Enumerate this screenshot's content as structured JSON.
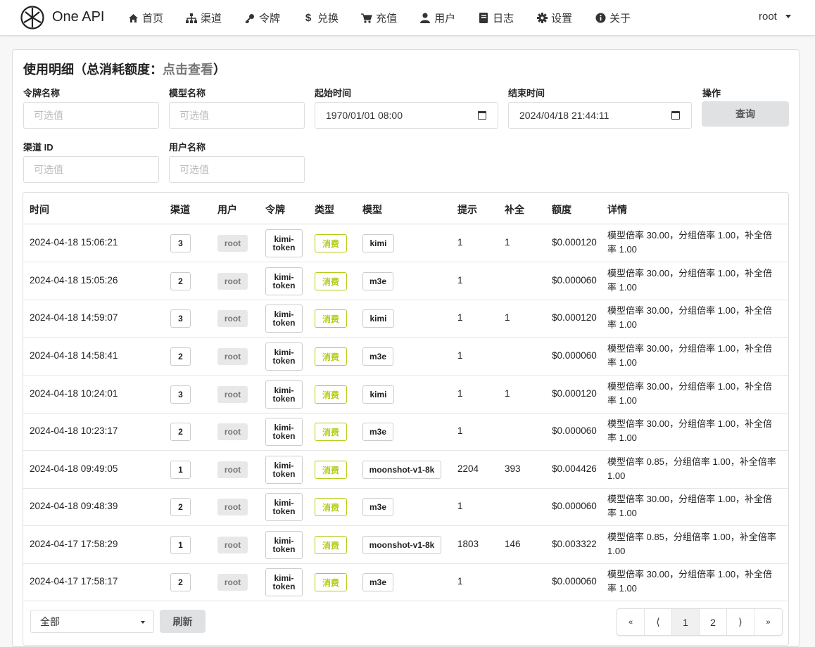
{
  "nav": {
    "brand": "One API",
    "items": [
      {
        "label": "首页",
        "icon": "home-icon"
      },
      {
        "label": "渠道",
        "icon": "sitemap-icon"
      },
      {
        "label": "令牌",
        "icon": "key-icon"
      },
      {
        "label": "兑换",
        "icon": "dollar-icon"
      },
      {
        "label": "充值",
        "icon": "cart-icon"
      },
      {
        "label": "用户",
        "icon": "user-icon"
      },
      {
        "label": "日志",
        "icon": "book-icon"
      },
      {
        "label": "设置",
        "icon": "gear-icon"
      },
      {
        "label": "关于",
        "icon": "info-icon"
      }
    ],
    "user": "root"
  },
  "card": {
    "title_prefix": "使用明细（总消耗额度：",
    "title_link": "点击查看",
    "title_suffix": "）"
  },
  "filters": {
    "token_label": "令牌名称",
    "token_placeholder": "可选值",
    "model_label": "模型名称",
    "model_placeholder": "可选值",
    "start_label": "起始时间",
    "start_value": "1970/01/01 08:00",
    "end_label": "结束时间",
    "end_value": "2024/04/18 21:44:11",
    "action_label": "操作",
    "query_button": "查询",
    "channel_label": "渠道 ID",
    "channel_placeholder": "可选值",
    "username_label": "用户名称",
    "username_placeholder": "可选值"
  },
  "table": {
    "headers": {
      "time": "时间",
      "channel": "渠道",
      "user": "用户",
      "token": "令牌",
      "type": "类型",
      "model": "模型",
      "prompt": "提示",
      "completion": "补全",
      "quota": "额度",
      "detail": "详情"
    },
    "rows": [
      {
        "time": "2024-04-18 15:06:21",
        "channel": "3",
        "user": "root",
        "token_a": "kimi-",
        "token_b": "token",
        "type": "消费",
        "model": "kimi",
        "prompt": "1",
        "completion": "1",
        "quota": "$0.000120",
        "detail": "模型倍率 30.00，分组倍率 1.00，补全倍率 1.00"
      },
      {
        "time": "2024-04-18 15:05:26",
        "channel": "2",
        "user": "root",
        "token_a": "kimi-",
        "token_b": "token",
        "type": "消费",
        "model": "m3e",
        "prompt": "1",
        "completion": "",
        "quota": "$0.000060",
        "detail": "模型倍率 30.00，分组倍率 1.00，补全倍率 1.00"
      },
      {
        "time": "2024-04-18 14:59:07",
        "channel": "3",
        "user": "root",
        "token_a": "kimi-",
        "token_b": "token",
        "type": "消费",
        "model": "kimi",
        "prompt": "1",
        "completion": "1",
        "quota": "$0.000120",
        "detail": "模型倍率 30.00，分组倍率 1.00，补全倍率 1.00"
      },
      {
        "time": "2024-04-18 14:58:41",
        "channel": "2",
        "user": "root",
        "token_a": "kimi-",
        "token_b": "token",
        "type": "消费",
        "model": "m3e",
        "prompt": "1",
        "completion": "",
        "quota": "$0.000060",
        "detail": "模型倍率 30.00，分组倍率 1.00，补全倍率 1.00"
      },
      {
        "time": "2024-04-18 10:24:01",
        "channel": "3",
        "user": "root",
        "token_a": "kimi-",
        "token_b": "token",
        "type": "消费",
        "model": "kimi",
        "prompt": "1",
        "completion": "1",
        "quota": "$0.000120",
        "detail": "模型倍率 30.00，分组倍率 1.00，补全倍率 1.00"
      },
      {
        "time": "2024-04-18 10:23:17",
        "channel": "2",
        "user": "root",
        "token_a": "kimi-",
        "token_b": "token",
        "type": "消费",
        "model": "m3e",
        "prompt": "1",
        "completion": "",
        "quota": "$0.000060",
        "detail": "模型倍率 30.00，分组倍率 1.00，补全倍率 1.00"
      },
      {
        "time": "2024-04-18 09:49:05",
        "channel": "1",
        "user": "root",
        "token_a": "kimi-",
        "token_b": "token",
        "type": "消费",
        "model": "moonshot-v1-8k",
        "prompt": "2204",
        "completion": "393",
        "quota": "$0.004426",
        "detail": "模型倍率 0.85，分组倍率 1.00，补全倍率 1.00"
      },
      {
        "time": "2024-04-18 09:48:39",
        "channel": "2",
        "user": "root",
        "token_a": "kimi-",
        "token_b": "token",
        "type": "消费",
        "model": "m3e",
        "prompt": "1",
        "completion": "",
        "quota": "$0.000060",
        "detail": "模型倍率 30.00，分组倍率 1.00，补全倍率 1.00"
      },
      {
        "time": "2024-04-17 17:58:29",
        "channel": "1",
        "user": "root",
        "token_a": "kimi-",
        "token_b": "token",
        "type": "消费",
        "model": "moonshot-v1-8k",
        "prompt": "1803",
        "completion": "146",
        "quota": "$0.003322",
        "detail": "模型倍率 0.85，分组倍率 1.00，补全倍率 1.00"
      },
      {
        "time": "2024-04-17 17:58:17",
        "channel": "2",
        "user": "root",
        "token_a": "kimi-",
        "token_b": "token",
        "type": "消费",
        "model": "m3e",
        "prompt": "1",
        "completion": "",
        "quota": "$0.000060",
        "detail": "模型倍率 30.00，分组倍率 1.00，补全倍率 1.00"
      }
    ]
  },
  "footer": {
    "select_value": "全部",
    "refresh_button": "刷新",
    "pager": {
      "first": "«",
      "prev": "⟨",
      "page1": "1",
      "page2": "2",
      "next": "⟩",
      "last": "»"
    }
  },
  "colors": {
    "consume_green": "#b5cc18",
    "button_gray": "#e0e1e2"
  }
}
